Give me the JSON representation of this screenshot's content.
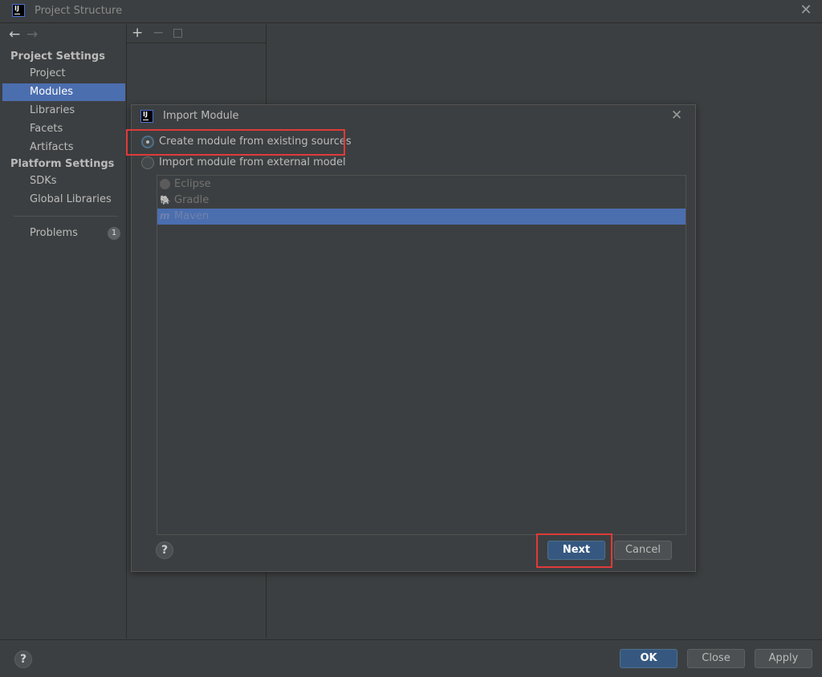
{
  "window": {
    "title": "Project Structure",
    "icon_label": "IJ"
  },
  "sidebar": {
    "back_icon": "←",
    "forward_icon": "→",
    "sections": [
      {
        "label": "Project Settings",
        "items": [
          "Project",
          "Modules",
          "Libraries",
          "Facets",
          "Artifacts"
        ]
      },
      {
        "label": "Platform Settings",
        "items": [
          "SDKs",
          "Global Libraries"
        ]
      }
    ],
    "selected": "Modules",
    "problems_label": "Problems",
    "problems_count": "1"
  },
  "middle_toolbar": {
    "add_icon": "+",
    "remove_icon": "−"
  },
  "dialog": {
    "title": "Import Module",
    "icon_label": "IJ",
    "close_icon": "✕",
    "options": [
      {
        "label": "Create module from existing sources",
        "selected": true
      },
      {
        "label": "Import module from external model",
        "selected": false
      }
    ],
    "models": [
      {
        "label": "Eclipse",
        "icon": "eclipse-icon"
      },
      {
        "label": "Gradle",
        "icon": "gradle-icon"
      },
      {
        "label": "Maven",
        "icon": "maven-icon",
        "selected": true
      }
    ],
    "help_label": "?",
    "next_label": "Next",
    "cancel_label": "Cancel"
  },
  "footer": {
    "help_label": "?",
    "ok_label": "OK",
    "close_label": "Close",
    "apply_label": "Apply"
  },
  "colors": {
    "background": "#3c3f41",
    "selection": "#4b6eaf",
    "primary_button": "#365880",
    "highlight": "#e03a3a"
  }
}
